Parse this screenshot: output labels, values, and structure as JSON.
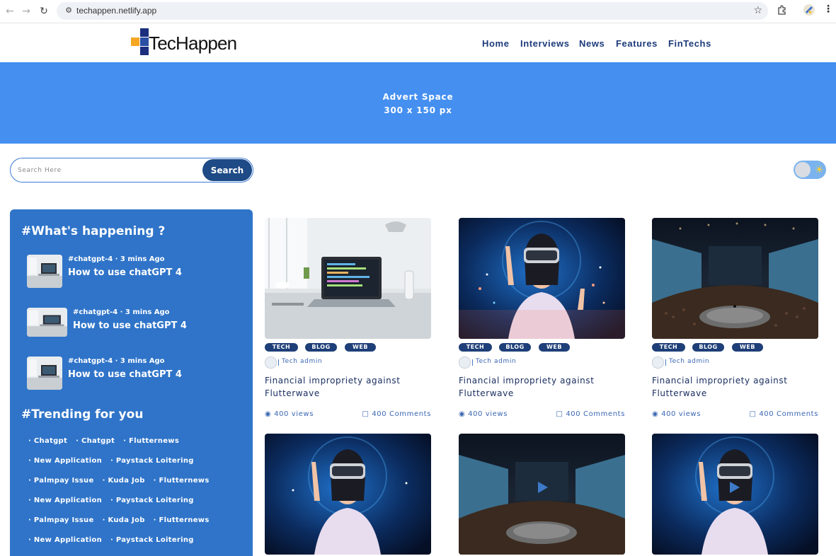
{
  "browser": {
    "back_icon": "arrow-left",
    "forward_icon": "arrow-right",
    "reload_icon": "reload",
    "site_settings_icon": "tune",
    "url": "techappen.netlify.app",
    "bookmark_icon": "star",
    "extensions_icon": "puzzle",
    "menu_icon": "kebab"
  },
  "header": {
    "logo_text": "TecHappen",
    "logo_colors": [
      "#1b2f7e",
      "#f5a623",
      "#2a4fa3"
    ],
    "nav": [
      "Home",
      "Interviews",
      "News",
      "Features",
      "FinTechs"
    ]
  },
  "advert": {
    "line1": "Advert Space",
    "line2": "300 x 150 px",
    "bg_color": "#448ff0"
  },
  "search": {
    "placeholder": "Search Here",
    "button_label": "Search"
  },
  "theme_toggle": {
    "state": "light",
    "icon": "sun"
  },
  "sidebar": {
    "bg_color": "#2f74c9",
    "happening_title": "#What's happening ?",
    "happening": [
      {
        "meta": "#chatgpt-4 · 3 mins Ago",
        "title": "How to use chatGPT 4"
      },
      {
        "meta": "#chatgpt-4 · 3 mins Ago",
        "title": "How to use chatGPT 4"
      },
      {
        "meta": "#chatgpt-4 · 3 mins Ago",
        "title": "How to use chatGPT 4"
      }
    ],
    "trending_title": "#Trending for you",
    "trending_rows": [
      [
        "· Chatgpt",
        "· Chatgpt",
        "· Flutternews"
      ],
      [
        "· New Application",
        "· Paystack Loitering"
      ],
      [
        "· Palmpay Issue",
        "· Kuda Job",
        "· Flutternews"
      ],
      [
        "· New Application",
        "· Paystack Loitering"
      ],
      [
        "· Palmpay Issue",
        "· Kuda Job",
        "· Flutternews"
      ],
      [
        "· New Application",
        "· Paystack Loitering"
      ]
    ]
  },
  "cards": [
    {
      "image": "laptop-desk",
      "tags": [
        "TECH",
        "BLOG",
        "WEB"
      ],
      "author": "Tech admin",
      "title": "Financial impropriety against Flutterwave",
      "views": "400 views",
      "comments": "400 Comments"
    },
    {
      "image": "vr-woman",
      "tags": [
        "TECH",
        "BLOG",
        "WEB"
      ],
      "author": "Tech admin",
      "title": "Financial impropriety against Flutterwave",
      "views": "400 views",
      "comments": "400 Comments"
    },
    {
      "image": "conference-hall",
      "tags": [
        "TECH",
        "BLOG",
        "WEB"
      ],
      "author": "Tech admin",
      "title": "Financial impropriety against Flutterwave",
      "views": "400 views",
      "comments": "400 Comments"
    },
    {
      "image": "vr-woman"
    },
    {
      "image": "conference-hall"
    },
    {
      "image": "vr-woman"
    }
  ]
}
